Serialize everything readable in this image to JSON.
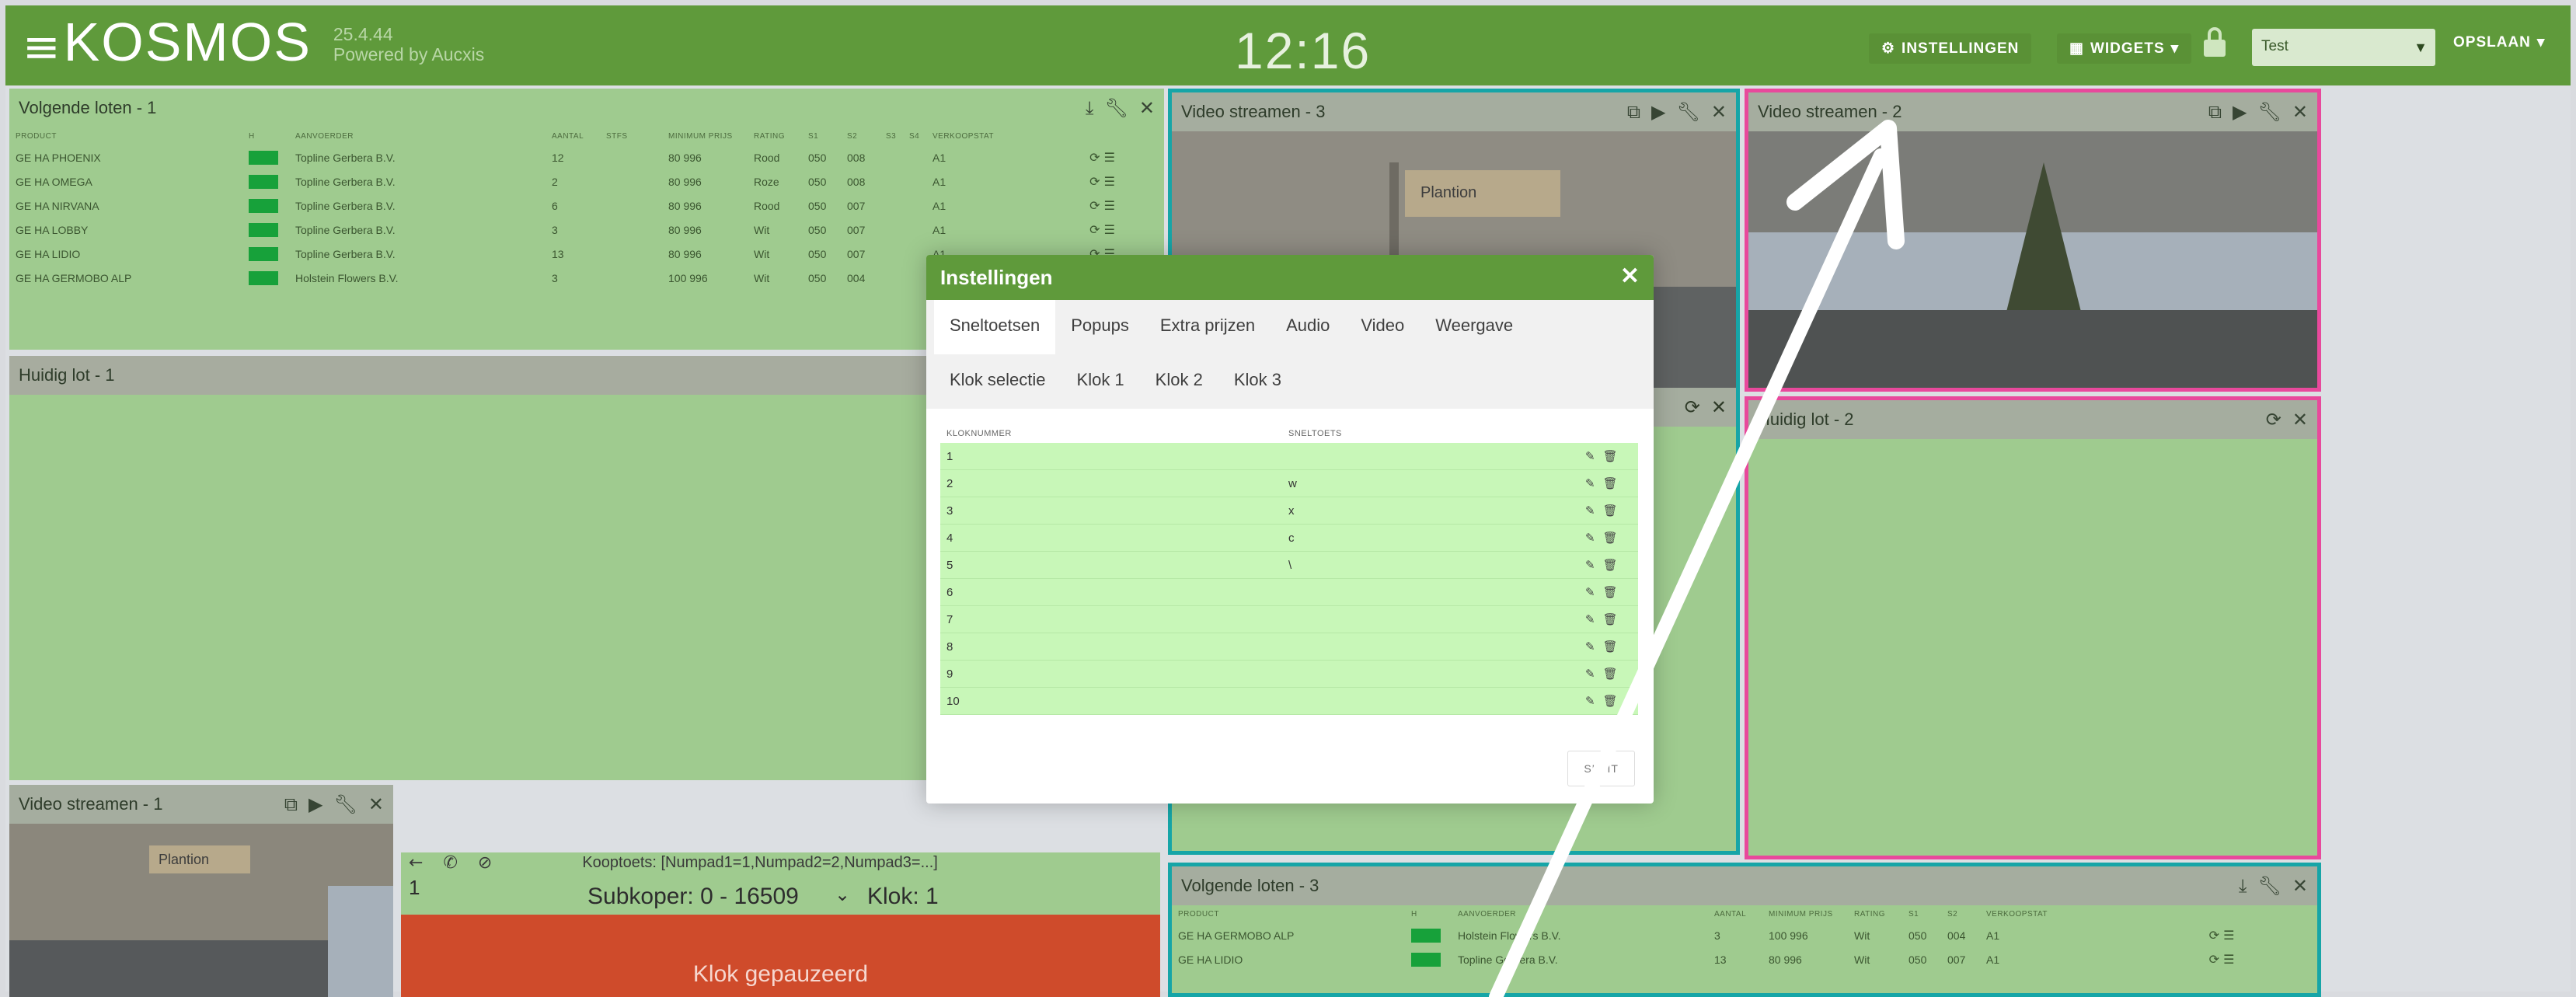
{
  "topbar": {
    "menu_icon": "menu-icon",
    "logo": "KOSMOS",
    "version": "25.4.44",
    "powered_by": "Powered by Aucxis",
    "clock": "12:16",
    "settings_label": "INSTELLINGEN",
    "widgets_label": "WIDGETS",
    "select_value": "Test",
    "save_label": "OPSLAAN",
    "colors": {
      "bar": "#5f9a3b",
      "accent_teal": "#16a5a7",
      "accent_pink": "#e8499c",
      "paused_red": "#cf4b2b"
    }
  },
  "panel_volgende_1": {
    "title": "Volgende loten - 1",
    "columns": [
      "PRODUCT",
      "H",
      "AANVOERDER",
      "AANTAL",
      "STFS",
      "MINIMUM PRIJS",
      "RATING",
      "S1",
      "S2",
      "S3",
      "S4",
      "VERKOOPSTAT"
    ],
    "rows": [
      [
        "GE HA PHOENIX",
        "Topline Gerbera B.V.",
        "12",
        "",
        "",
        "80 996",
        "Rood",
        "050",
        "008",
        "A1"
      ],
      [
        "GE HA OMEGA",
        "Topline Gerbera B.V.",
        "2",
        "",
        "",
        "80 996",
        "Roze",
        "050",
        "008",
        "A1"
      ],
      [
        "GE HA NIRVANA",
        "Topline Gerbera B.V.",
        "6",
        "",
        "",
        "80 996",
        "Rood",
        "050",
        "007",
        "A1"
      ],
      [
        "GE HA LOBBY",
        "Topline Gerbera B.V.",
        "3",
        "",
        "",
        "80 996",
        "Wit",
        "050",
        "007",
        "A1"
      ],
      [
        "GE HA LIDIO",
        "Topline Gerbera B.V.",
        "13",
        "",
        "",
        "80 996",
        "Wit",
        "050",
        "007",
        "A1"
      ],
      [
        "GE HA GERMOBO ALP",
        "Holstein Flowers B.V.",
        "3",
        "",
        "",
        "100 996",
        "Wit",
        "050",
        "004",
        "A1"
      ]
    ]
  },
  "panel_huidig_1": {
    "title": "Huidig lot - 1"
  },
  "panel_video_3": {
    "title": "Video streamen - 3",
    "sign": "Plantion"
  },
  "panel_video_2": {
    "title": "Video streamen - 2"
  },
  "panel_huidig_2": {
    "title": "Huidig lot - 2"
  },
  "panel_video_1": {
    "title": "Video streamen - 1",
    "sign": "Plantion"
  },
  "panel_volgende_3": {
    "title": "Volgende loten - 3",
    "rows": [
      [
        "GE HA GERMOBO ALP",
        "Holstein Flowers B.V.",
        "3",
        "100 996",
        "Wit",
        "050",
        "004",
        "A1"
      ],
      [
        "GE HA LIDIO",
        "Topline Gerbera B.V.",
        "13",
        "80 996",
        "Wit",
        "050",
        "007",
        "A1"
      ]
    ]
  },
  "klok_panel": {
    "kooptoets": "Kooptoets: [Numpad1=1,Numpad2=2,Numpad3=...]",
    "klok_number": "1",
    "subkoper": "Subkoper: 0 - 16509",
    "klok": "Klok: 1",
    "paused": "Klok gepauzeerd"
  },
  "modal": {
    "title": "Instellingen",
    "tabs": [
      "Sneltoetsen",
      "Popups",
      "Extra prijzen",
      "Audio",
      "Video",
      "Weergave",
      "Klok selectie",
      "Klok 1",
      "Klok 2",
      "Klok 3"
    ],
    "active_tab": "Sneltoetsen",
    "columns": [
      "KLOKNUMMER",
      "SNELTOETS"
    ],
    "rows": [
      {
        "num": "1",
        "key": ""
      },
      {
        "num": "2",
        "key": "w"
      },
      {
        "num": "3",
        "key": "x"
      },
      {
        "num": "4",
        "key": "c"
      },
      {
        "num": "5",
        "key": "\\"
      },
      {
        "num": "6",
        "key": ""
      },
      {
        "num": "7",
        "key": ""
      },
      {
        "num": "8",
        "key": ""
      },
      {
        "num": "9",
        "key": ""
      },
      {
        "num": "10",
        "key": ""
      }
    ],
    "close_label": "SLUIT"
  }
}
